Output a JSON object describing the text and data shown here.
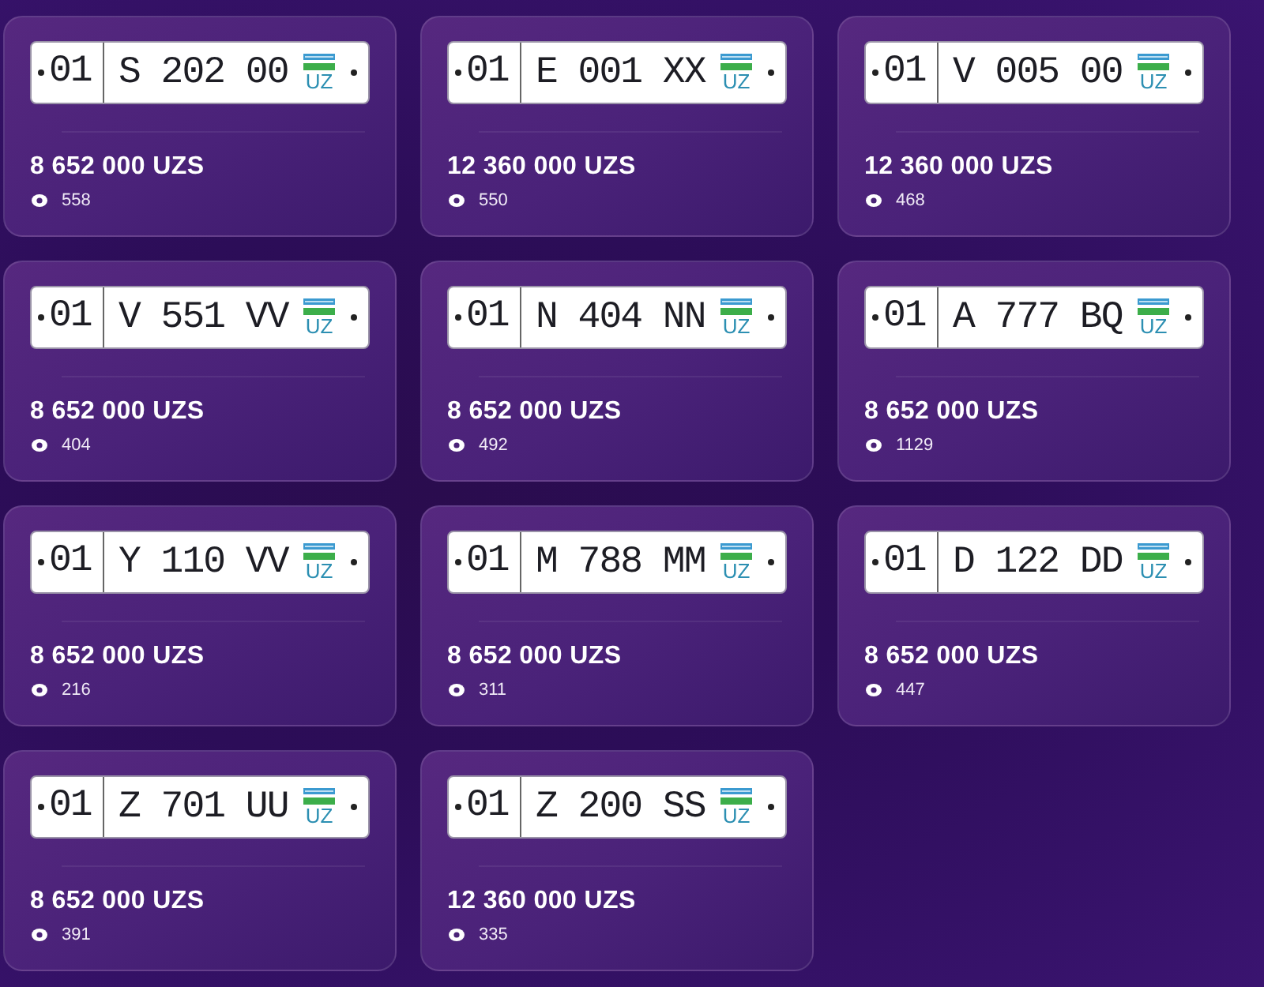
{
  "listings": [
    {
      "plate": {
        "region": "01",
        "number": "S 202 00",
        "country": "UZ"
      },
      "price": "8 652 000 UZS",
      "views": "558"
    },
    {
      "plate": {
        "region": "01",
        "number": "E 001 XX",
        "country": "UZ"
      },
      "price": "12 360 000 UZS",
      "views": "550"
    },
    {
      "plate": {
        "region": "01",
        "number": "V 005 00",
        "country": "UZ"
      },
      "price": "12 360 000 UZS",
      "views": "468"
    },
    {
      "plate": {
        "region": "01",
        "number": "V 551 VV",
        "country": "UZ"
      },
      "price": "8 652 000 UZS",
      "views": "404"
    },
    {
      "plate": {
        "region": "01",
        "number": "N 404 NN",
        "country": "UZ"
      },
      "price": "8 652 000 UZS",
      "views": "492"
    },
    {
      "plate": {
        "region": "01",
        "number": "A 777 BQ",
        "country": "UZ"
      },
      "price": "8 652 000 UZS",
      "views": "1129"
    },
    {
      "plate": {
        "region": "01",
        "number": "Y 110 VV",
        "country": "UZ"
      },
      "price": "8 652 000 UZS",
      "views": "216"
    },
    {
      "plate": {
        "region": "01",
        "number": "M 788 MM",
        "country": "UZ"
      },
      "price": "8 652 000 UZS",
      "views": "311"
    },
    {
      "plate": {
        "region": "01",
        "number": "D 122 DD",
        "country": "UZ"
      },
      "price": "8 652 000 UZS",
      "views": "447"
    },
    {
      "plate": {
        "region": "01",
        "number": "Z 701 UU",
        "country": "UZ"
      },
      "price": "8 652 000 UZS",
      "views": "391"
    },
    {
      "plate": {
        "region": "01",
        "number": "Z 200 SS",
        "country": "UZ"
      },
      "price": "12 360 000 UZS",
      "views": "335"
    }
  ]
}
